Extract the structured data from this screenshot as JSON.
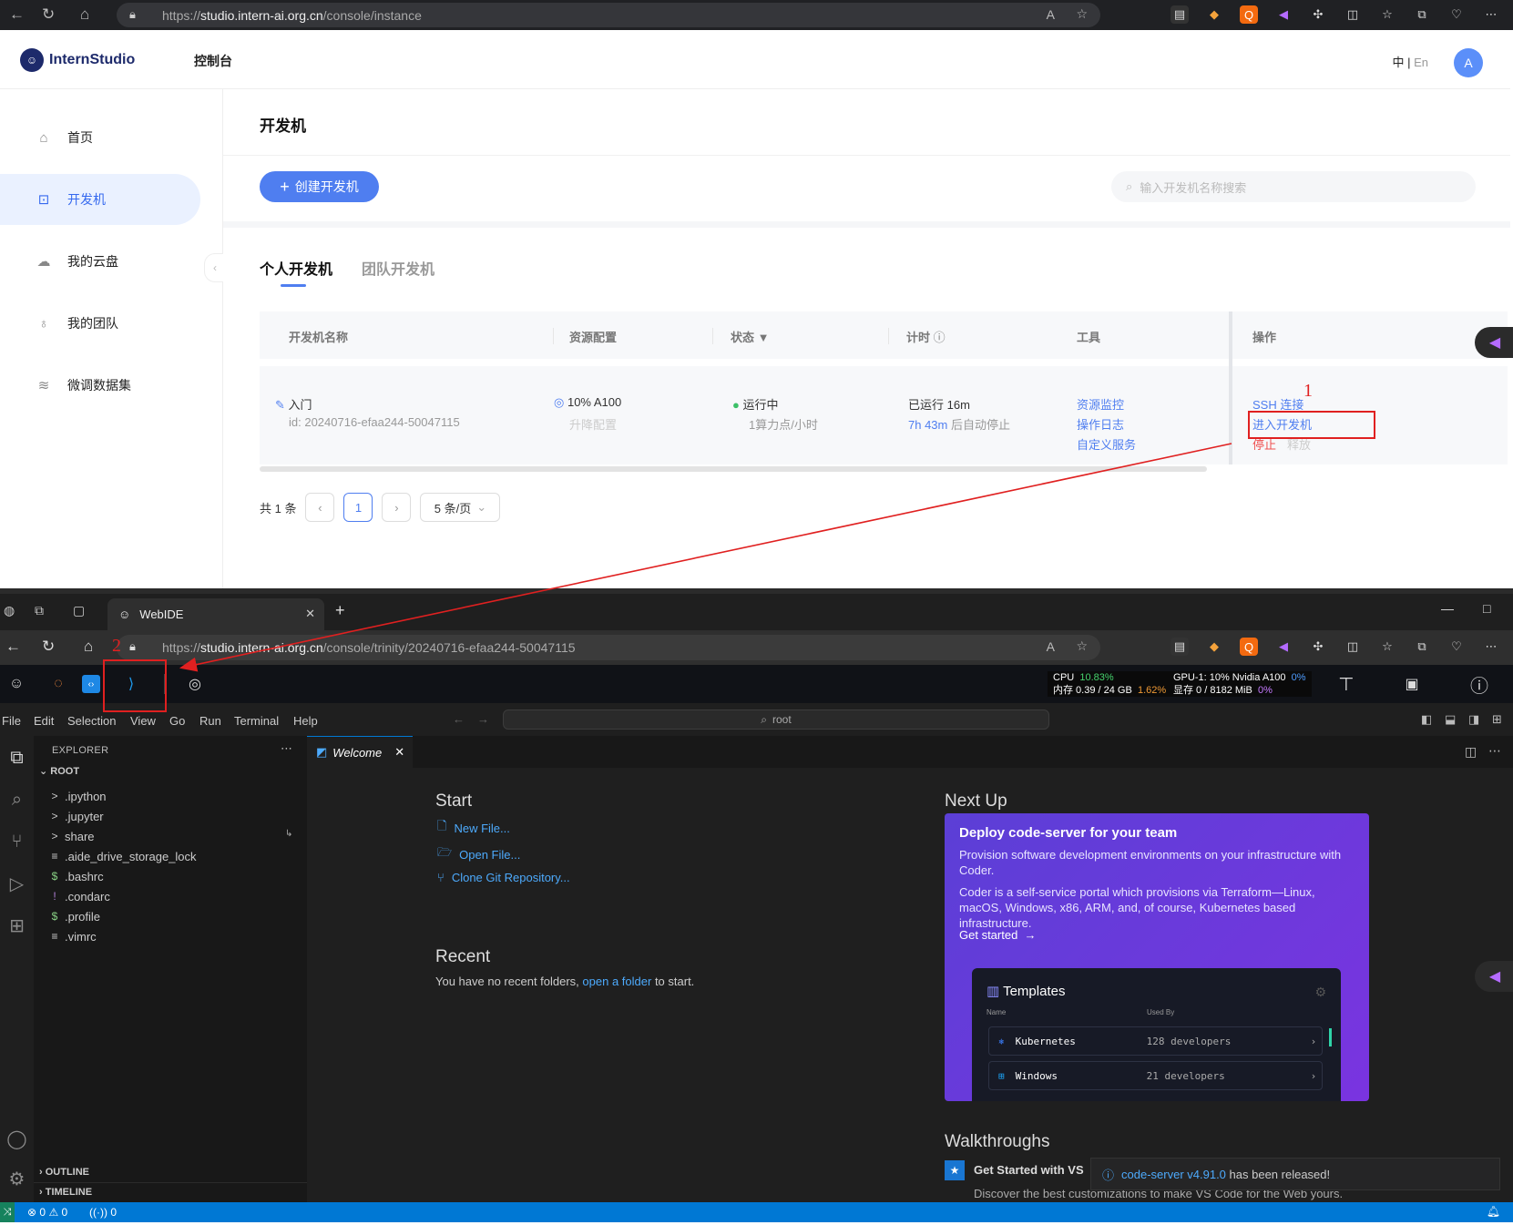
{
  "top_browser": {
    "url_prefix": "https://",
    "url_host": "studio.intern-ai.org.cn",
    "url_path": "/console/instance"
  },
  "console": {
    "logo_text": "InternStudio",
    "nav_console": "控制台",
    "lang_zh": "中",
    "lang_sep": "|",
    "lang_en": "En",
    "avatar_letter": "A",
    "sidebar": [
      {
        "label": "首页",
        "icon": "home-icon"
      },
      {
        "label": "开发机",
        "icon": "terminal-icon"
      },
      {
        "label": "我的云盘",
        "icon": "cloud-icon"
      },
      {
        "label": "我的团队",
        "icon": "team-icon"
      },
      {
        "label": "微调数据集",
        "icon": "dataset-icon"
      }
    ],
    "page_title": "开发机",
    "create_button": "创建开发机",
    "search_placeholder": "输入开发机名称搜索",
    "tabs": [
      "个人开发机",
      "团队开发机"
    ],
    "columns": [
      "开发机名称",
      "资源配置",
      "状态",
      "计时",
      "工具",
      "操作"
    ],
    "row": {
      "name": "入门",
      "id": "id: 20240716-efaa244-50047115",
      "resource": "10% A100",
      "resource_sub": "升降配置",
      "status": "运行中",
      "status_sub": "1算力点/小时",
      "timer": "已运行  16m",
      "timer_sub_time": "7h 43m",
      "timer_sub_text": " 后自动停止",
      "tools": [
        "资源监控",
        "操作日志",
        "自定义服务"
      ],
      "ops_ssh": "SSH 连接",
      "ops_enter": "进入开发机",
      "ops_stop": "停止",
      "ops_release": "释放"
    },
    "pagination": {
      "total": "共 1 条",
      "current_page": "1",
      "page_size": "5 条/页"
    }
  },
  "second_window": {
    "tab_title": "WebIDE",
    "url_prefix": "https://",
    "url_host": "studio.intern-ai.org.cn",
    "url_path": "/console/trinity/20240716-efaa244-50047115",
    "stats": {
      "cpu_label": "CPU",
      "cpu_value": "10.83%",
      "mem_label": "内存 0.39 / 24 GB",
      "mem_value": "1.62%",
      "gpu_label": "GPU-1: 10% Nvidia A100",
      "gpu_value": "0%",
      "vram_label": "显存 0 / 8182 MiB",
      "vram_value": "0%"
    }
  },
  "vscode": {
    "menu": [
      "File",
      "Edit",
      "Selection",
      "View",
      "Go",
      "Run",
      "Terminal",
      "Help"
    ],
    "command_center": "root",
    "explorer_title": "EXPLORER",
    "root_label": "ROOT",
    "files": [
      {
        "name": ".ipython",
        "icon": ">"
      },
      {
        "name": ".jupyter",
        "icon": ">"
      },
      {
        "name": "share",
        "icon": ">"
      },
      {
        "name": ".aide_drive_storage_lock",
        "icon": "≡"
      },
      {
        "name": ".bashrc",
        "icon": "$"
      },
      {
        "name": ".condarc",
        "icon": "!"
      },
      {
        "name": ".profile",
        "icon": "$"
      },
      {
        "name": ".vimrc",
        "icon": "≡"
      }
    ],
    "outline_label": "OUTLINE",
    "timeline_label": "TIMELINE",
    "editor_tab": "Welcome",
    "start_heading": "Start",
    "start_links": [
      "New File...",
      "Open File...",
      "Clone Git Repository..."
    ],
    "recent_heading": "Recent",
    "recent_text_pre": "You have no recent folders, ",
    "recent_link": "open a folder",
    "recent_text_post": " to start.",
    "next_up_heading": "Next Up",
    "card_title": "Deploy code-server for your team",
    "card_desc1": "Provision software development environments on your infrastructure with Coder.",
    "card_desc2": "Coder is a self-service portal which provisions via Terraform—Linux, macOS, Windows, x86, ARM, and, of course, Kubernetes based infrastructure.",
    "card_cta": "Get started",
    "templates_title": "Templates",
    "templates_col_name": "Name",
    "templates_col_used": "Used By",
    "templates": [
      {
        "name": "Kubernetes",
        "used": "128 developers"
      },
      {
        "name": "Windows",
        "used": "21 developers"
      }
    ],
    "walkthroughs_heading": "Walkthroughs",
    "walkthrough_title": "Get Started with VS",
    "walkthrough_sub": "Discover the best customizations to make VS Code for the Web yours.",
    "notification_link": "code-server v4.91.0",
    "notification_text": " has been released!",
    "status_errors": "0",
    "status_warnings": "0",
    "status_ports": "0"
  },
  "annotations": {
    "label_1": "1",
    "label_2": "2"
  },
  "colors": {
    "accent": "#4f7ef0",
    "danger": "#ef4f4f",
    "annotation": "#e02020",
    "vscode_blue": "#0078d4"
  }
}
